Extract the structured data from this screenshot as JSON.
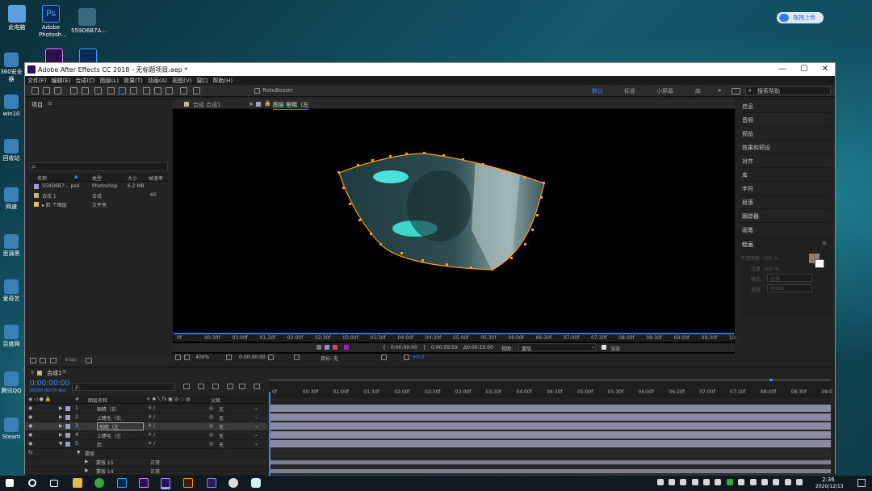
{
  "desktop": {
    "icons": [
      {
        "label": "此电脑",
        "x": "",
        "color": "#5aa0e0"
      },
      {
        "label": "Adobe Photosh...",
        "color": "#0a2a55"
      },
      {
        "label": "559D6B7A...",
        "color": "#3a6a80"
      }
    ],
    "left_labels": [
      "360安全\n器",
      "win10",
      "回收站",
      "网速",
      "思源黑",
      "爱奇艺",
      "百度网",
      "腾讯QQ",
      "Steam"
    ],
    "upload_pill": "拖拽上传"
  },
  "window": {
    "title": "Adobe After Effects CC 2018 - 无标题项目.aep *",
    "controls": {
      "minimize": "—",
      "maximize": "☐",
      "close": "✕"
    },
    "menu": [
      "文件(F)",
      "编辑(E)",
      "合成(C)",
      "图层(L)",
      "效果(T)",
      "动画(A)",
      "视图(V)",
      "窗口",
      "帮助(H)"
    ],
    "toolbar": {
      "rotobezier": "RotoBezier",
      "workspaces": [
        "默认",
        "标准",
        "小屏幕",
        "库"
      ],
      "search_placeholder": "搜索帮助"
    },
    "project": {
      "tab": "项目",
      "search_placeholder": "ρ.",
      "columns": [
        "名称",
        "类型",
        "大小",
        "帧速率"
      ],
      "items": [
        {
          "name": "559D6B7... psd",
          "type": "Photoshop",
          "size": "6.2 MB",
          "fps": "",
          "color": "#9aa0c8"
        },
        {
          "name": "合成 1",
          "type": "合成",
          "size": "",
          "fps": "60",
          "color": "#c8b68a"
        },
        {
          "name": "▸ 脸 个图层",
          "type": "文件夹",
          "size": "",
          "fps": "",
          "color": "#e2c05a"
        }
      ],
      "bpc": "8 bpc"
    },
    "viewer": {
      "tabs": [
        "合成 合成1",
        "图层 眼睛（左"
      ],
      "ruler_ticks": [
        "0f",
        "00:30f",
        "01:00f",
        "01:30f",
        "02:00f",
        "02:30f",
        "03:00f",
        "03:30f",
        "04:00f",
        "04:30f",
        "05:00f",
        "05:30f",
        "06:00f",
        "06:30f",
        "07:00f",
        "07:30f",
        "08:00f",
        "08:30f",
        "09:00f",
        "09:30f",
        "10:"
      ],
      "time_a": "0:00:00:00",
      "time_b": "0:00:09:59",
      "time_c": "Δ0:00:10:00",
      "view_label": "视图:",
      "view_value": "蒙版",
      "render_label": "渲染",
      "zoom": "400%",
      "timecode": "0:00:00:00",
      "target": "目标: 无",
      "plus": "+0.0"
    },
    "right_panel": {
      "items": [
        "信息",
        "音频",
        "预览",
        "效果和预设",
        "对齐",
        "库",
        "字符",
        "段落",
        "跟踪器",
        "画笔"
      ],
      "paint": {
        "title": "绘画",
        "opacity": "不透明度: 100 %",
        "flow": "流量: 100 %",
        "mode_label": "模式:",
        "mode": "正常",
        "channel_label": "通道:",
        "channel": "RGBA"
      }
    },
    "timeline": {
      "tab": "合成1",
      "timecode": "0:00:00:00",
      "frames": "00000 (60.00 fps)",
      "search_placeholder": "ρ.",
      "headers": {
        "num": "#",
        "name": "图层名称",
        "parent": "父级"
      },
      "ticks": [
        "0f",
        "00:30f",
        "01:00f",
        "01:30f",
        "02:00f",
        "02:30f",
        "03:00f",
        "03:30f",
        "04:00f",
        "04:30f",
        "05:00f",
        "05:30f",
        "06:00f",
        "06:30f",
        "07:00f",
        "07:30f",
        "08:00f",
        "08:30f",
        "09:0"
      ],
      "layers": [
        {
          "num": "1",
          "name": "眼睛（右",
          "parent": "无"
        },
        {
          "num": "2",
          "name": "上睫毛（右",
          "parent": "无"
        },
        {
          "num": "3",
          "name": "眼睛（左",
          "parent": "无"
        },
        {
          "num": "4",
          "name": "上睫毛（左",
          "parent": "无"
        },
        {
          "num": "5",
          "name": "脸",
          "parent": "无"
        }
      ],
      "sublayers": [
        {
          "name": "蒙版",
          "value": ""
        },
        {
          "name": "蒙版 15",
          "value": "正常"
        },
        {
          "name": "蒙版 14",
          "value": "正常"
        }
      ]
    }
  },
  "taskbar": {
    "time": "2:36",
    "date": "2020/12/13"
  }
}
